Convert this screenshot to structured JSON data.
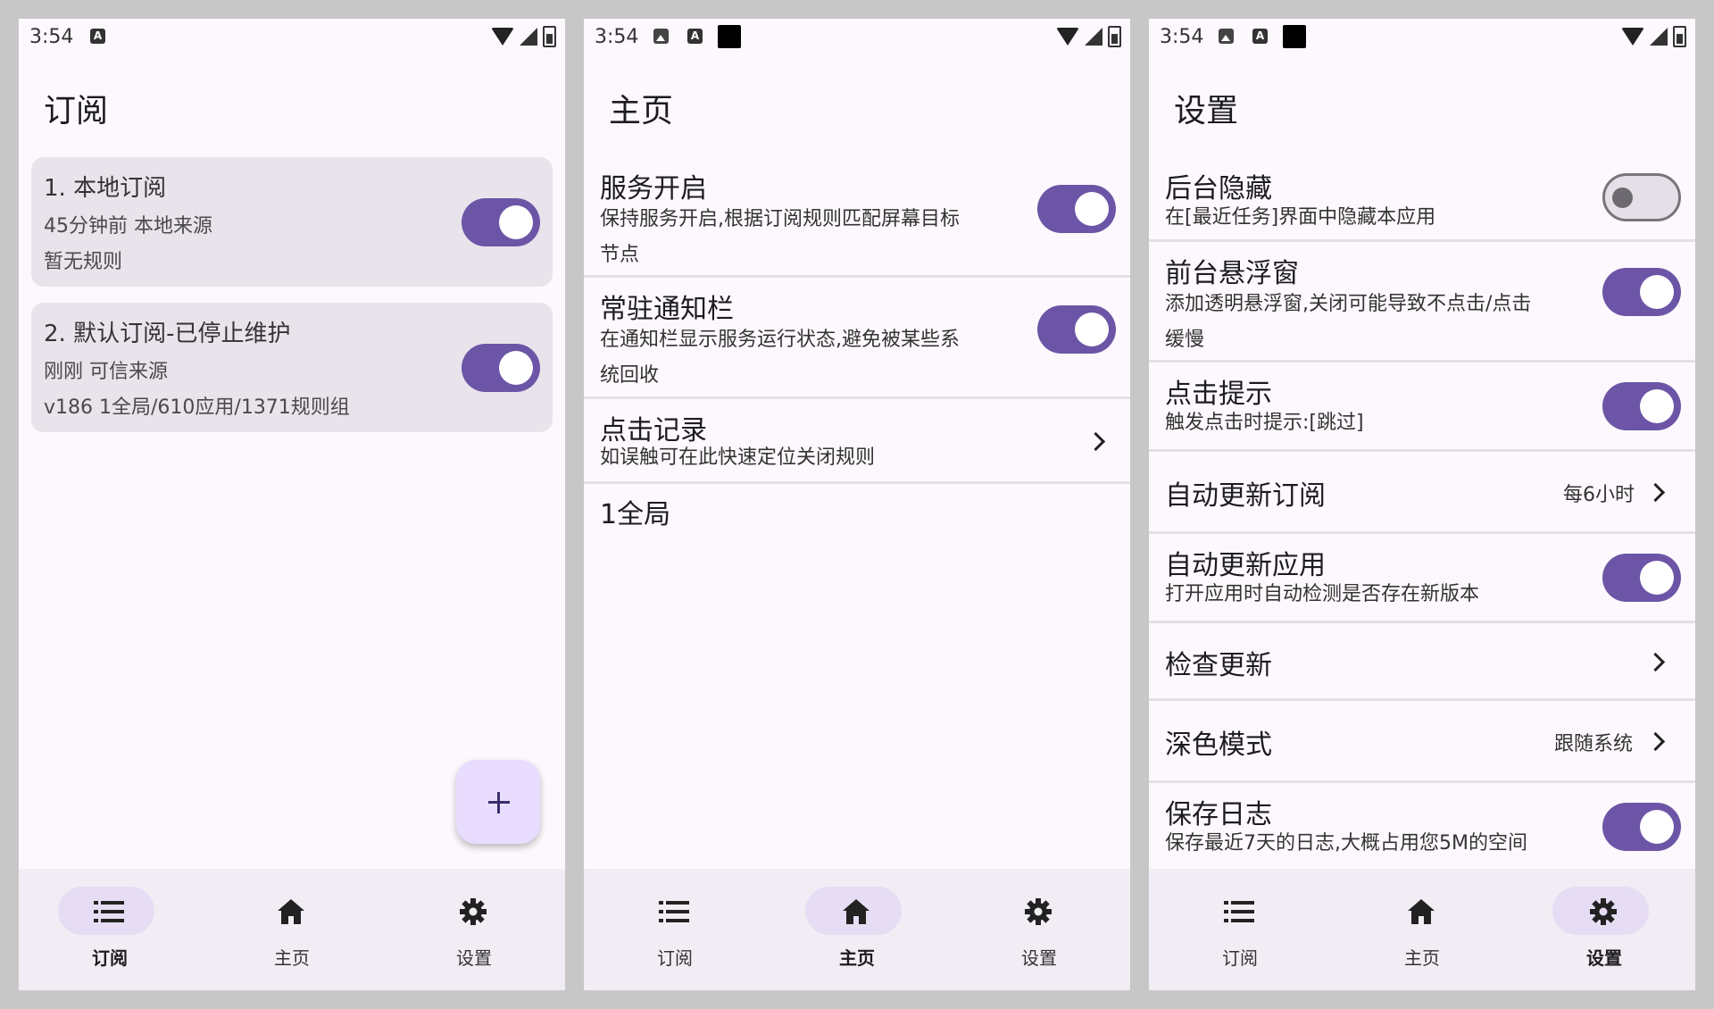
{
  "status": {
    "time": "3:54",
    "a_glyph": "A"
  },
  "nav": {
    "sub": "订阅",
    "home": "主页",
    "settings": "设置"
  },
  "screen1": {
    "title": "订阅",
    "cards": [
      {
        "title": "1. 本地订阅",
        "meta": "45分钟前   本地来源",
        "extra": "暂无规则",
        "enabled": true
      },
      {
        "title": "2. 默认订阅-已停止维护",
        "meta": "刚刚   可信来源",
        "extra": "v186   1全局/610应用/1371规则组",
        "enabled": true
      }
    ],
    "fab": "add-subscription"
  },
  "screen2": {
    "title": "主页",
    "rows": [
      {
        "title": "服务开启",
        "desc1": "保持服务开启,根据订阅规则匹配屏幕目标",
        "desc2": "节点",
        "toggle": true
      },
      {
        "title": "常驻通知栏",
        "desc1": "在通知栏显示服务运行状态,避免被某些系",
        "desc2": "统回收",
        "toggle": true
      },
      {
        "title": "点击记录",
        "desc1": "如误触可在此快速定位关闭规则"
      }
    ],
    "global": "1全局"
  },
  "screen3": {
    "title": "设置",
    "rows": [
      {
        "title": "后台隐藏",
        "desc": "在[最近任务]界面中隐藏本应用",
        "toggle": false
      },
      {
        "title": "前台悬浮窗",
        "desc1": "添加透明悬浮窗,关闭可能导致不点击/点击",
        "desc2": "缓慢",
        "toggle": true
      },
      {
        "title": "点击提示",
        "desc": "触发点击时提示:[跳过]",
        "toggle": true
      },
      {
        "title": "自动更新订阅",
        "value": "每6小时"
      },
      {
        "title": "自动更新应用",
        "desc": "打开应用时自动检测是否存在新版本",
        "toggle": true
      },
      {
        "title": "检查更新"
      },
      {
        "title": "深色模式",
        "value": "跟随系统"
      },
      {
        "title": "保存日志",
        "desc": "保存最近7天的日志,大概占用您5M的空间",
        "toggle": true
      }
    ]
  },
  "colors": {
    "accent": "#6c55a6",
    "background": "#fdf8fd",
    "card": "#e9e3ec",
    "nav": "#f2ecf4",
    "fab": "#e9ddff"
  }
}
